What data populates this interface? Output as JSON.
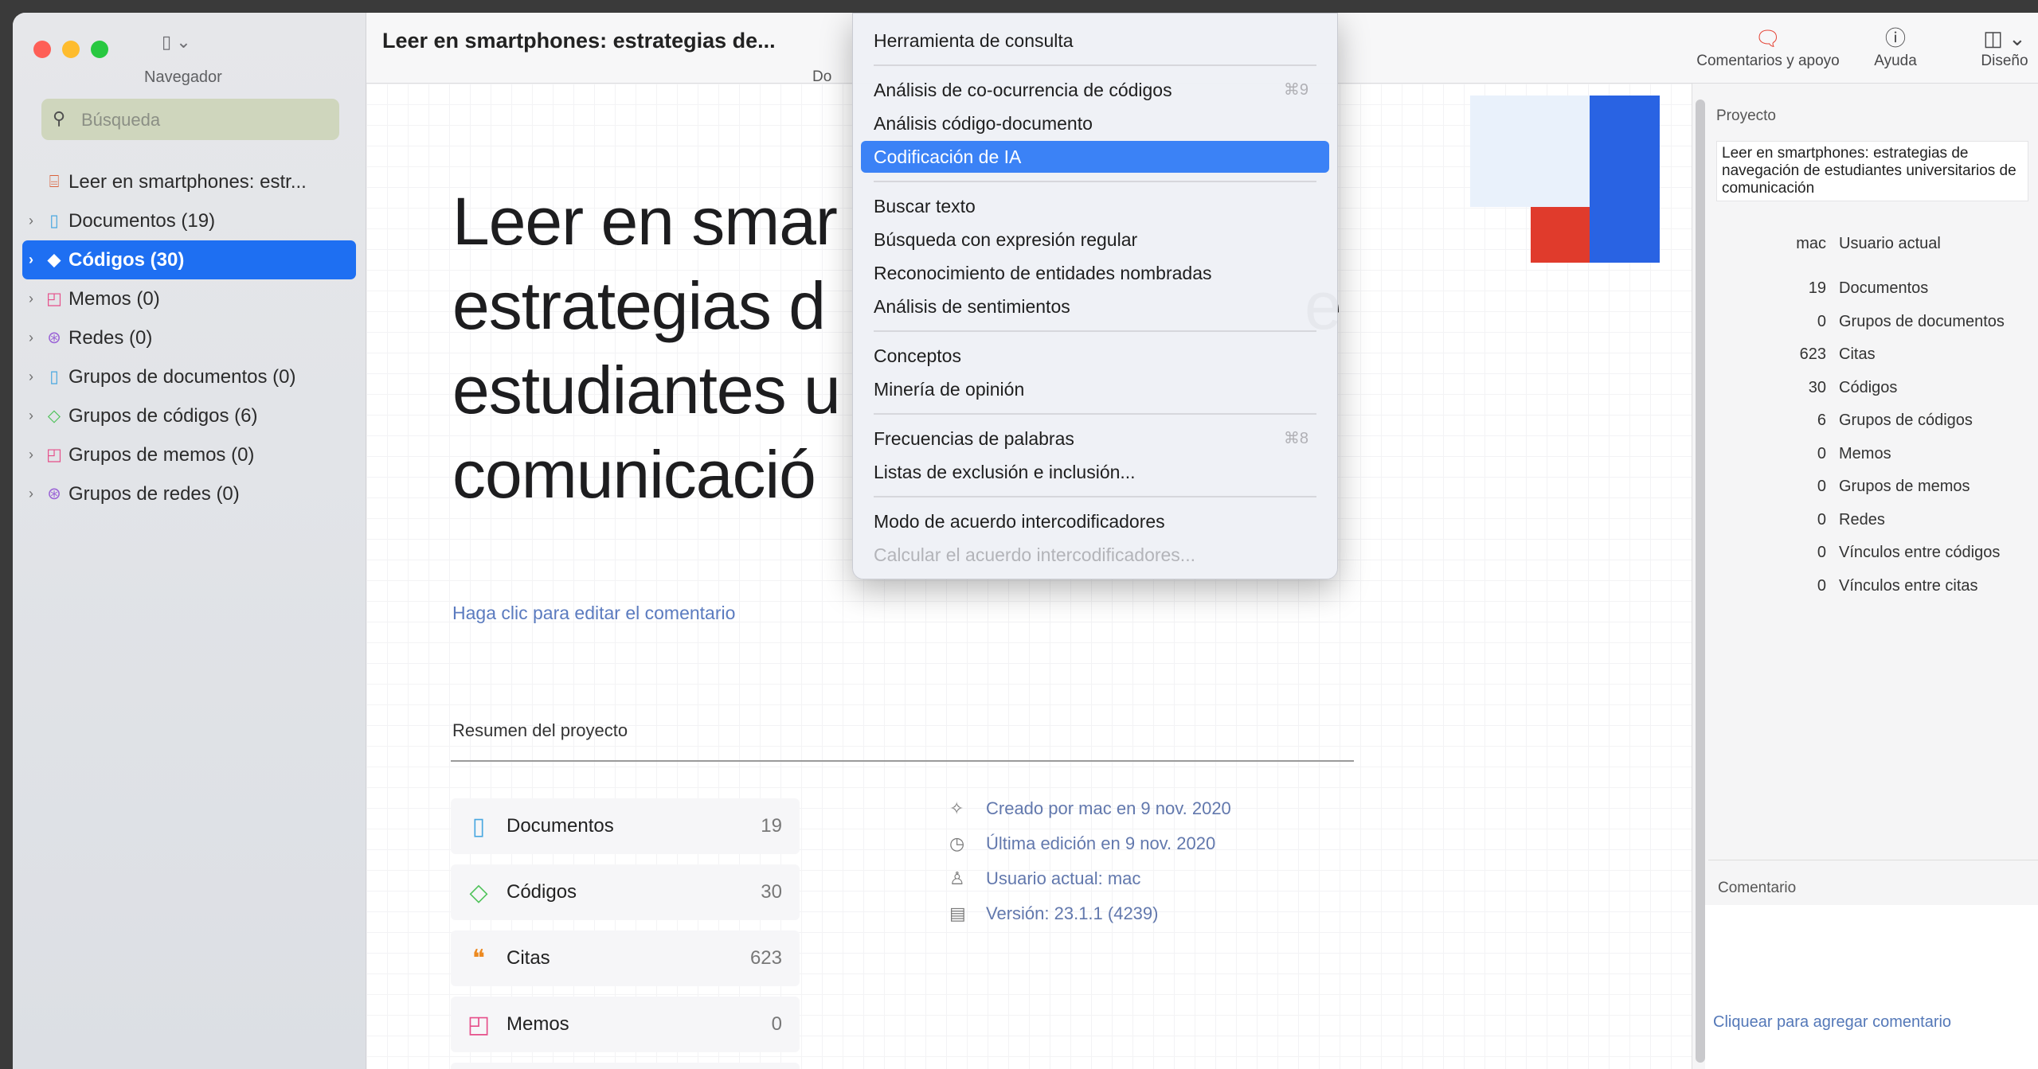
{
  "sidebar": {
    "nav_label": "Navegador",
    "search_placeholder": "Búsqueda",
    "items": [
      {
        "label": "Leer en smartphones: estr...",
        "icon": "project-icon"
      },
      {
        "label": "Documentos (19)",
        "icon": "document-icon"
      },
      {
        "label": "Códigos (30)",
        "icon": "code-diamond-icon",
        "selected": true
      },
      {
        "label": "Memos (0)",
        "icon": "memo-icon"
      },
      {
        "label": "Redes (0)",
        "icon": "network-icon"
      },
      {
        "label": "Grupos de documentos (0)",
        "icon": "document-group-icon"
      },
      {
        "label": "Grupos de códigos (6)",
        "icon": "code-group-icon"
      },
      {
        "label": "Grupos de memos (0)",
        "icon": "memo-group-icon"
      },
      {
        "label": "Grupos de redes (0)",
        "icon": "network-group-icon"
      }
    ]
  },
  "toolbar": {
    "doc_title": "Leer en smartphones: estrategias de...",
    "doc_sub": "Do",
    "comments_label": "Comentarios y apoyo",
    "help_label": "Ayuda",
    "design_label": "Diseño"
  },
  "menu": {
    "items": [
      {
        "label": "Herramienta de consulta"
      },
      {
        "label": "Análisis de co-ocurrencia de códigos",
        "shortcut": "⌘9"
      },
      {
        "label": "Análisis código-documento"
      },
      {
        "label": "Codificación de IA",
        "selected": true
      },
      {
        "label": "Buscar texto"
      },
      {
        "label": "Búsqueda con expresión regular"
      },
      {
        "label": "Reconocimiento de entidades nombradas"
      },
      {
        "label": "Análisis de sentimientos"
      },
      {
        "label": "Conceptos"
      },
      {
        "label": "Minería de opinión"
      },
      {
        "label": "Frecuencias de palabras",
        "shortcut": "⌘8"
      },
      {
        "label": "Listas de exclusión e inclusión..."
      },
      {
        "label": "Modo de acuerdo intercodificadores"
      },
      {
        "label": "Calcular el acuerdo intercodificadores...",
        "disabled": true
      }
    ]
  },
  "main": {
    "title_lines": [
      "Leer en smar",
      "estrategias d",
      "estudiantes u",
      "comunicació"
    ],
    "title_tail_line2": "e",
    "comment_link": "Haga clic para editar el comentario",
    "summary_heading": "Resumen del proyecto",
    "stats": [
      {
        "label": "Documentos",
        "value": "19",
        "icon": "document-icon"
      },
      {
        "label": "Códigos",
        "value": "30",
        "icon": "code-diamond-icon"
      },
      {
        "label": "Citas",
        "value": "623",
        "icon": "quote-icon"
      },
      {
        "label": "Memos",
        "value": "0",
        "icon": "memo-icon"
      }
    ],
    "meta": [
      {
        "text": "Creado por mac en 9 nov. 2020",
        "icon": "magic-wand-icon"
      },
      {
        "text": "Última edición en 9 nov. 2020",
        "icon": "clock-icon"
      },
      {
        "text": "Usuario actual: mac",
        "icon": "user-icon"
      },
      {
        "text": "Versión: 23.1.1 (4239)",
        "icon": "version-icon"
      }
    ]
  },
  "inspector": {
    "heading": "Proyecto",
    "project_name": "Leer en smartphones: estrategias de navegación de estudiantes universitarios de comunicación",
    "stats": [
      {
        "num": "mac",
        "label": "Usuario actual"
      },
      {
        "num": "19",
        "label": "Documentos"
      },
      {
        "num": "0",
        "label": "Grupos de documentos"
      },
      {
        "num": "623",
        "label": "Citas"
      },
      {
        "num": "30",
        "label": "Códigos"
      },
      {
        "num": "6",
        "label": "Grupos de códigos"
      },
      {
        "num": "0",
        "label": "Memos"
      },
      {
        "num": "0",
        "label": "Grupos de memos"
      },
      {
        "num": "0",
        "label": "Redes"
      },
      {
        "num": "0",
        "label": "Vínculos entre códigos"
      },
      {
        "num": "0",
        "label": "Vínculos entre citas"
      }
    ],
    "comment_heading": "Comentario",
    "comment_link": "Cliquear para agregar comentario"
  },
  "colors": {
    "accent": "#1e6ff2",
    "menu_selected": "#3b82f6",
    "deco_blue": "#2963e3",
    "deco_red": "#e03b2c",
    "deco_light": "#e9f1fb"
  }
}
